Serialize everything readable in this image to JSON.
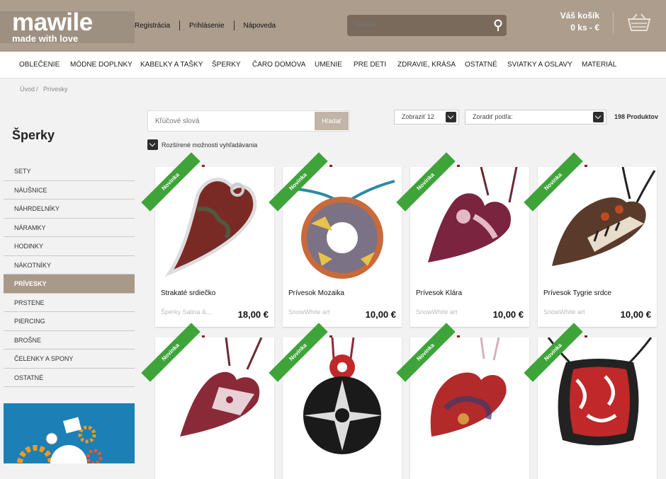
{
  "header": {
    "logo": "mawile",
    "tagline": "made with love",
    "links": [
      "Registrácia",
      "Prihlásenie",
      "Nápoveda"
    ],
    "search_placeholder": "Hľadať",
    "cart_label": "Váš košík",
    "cart_value": "0 ks - €"
  },
  "nav": [
    "OBLEČENIE",
    "MÓDNE DOPLNKY",
    "KABELKY A TAŠKY",
    "ŠPERKY",
    "ČARO DOMOVA",
    "UMENIE",
    "PRE DETI",
    "ZDRAVIE, KRÁSA",
    "OSTATNÉ",
    "SVIATKY A OSLAVY",
    "MATERIÁL"
  ],
  "breadcrumb": [
    "Úvod",
    "Prívesky"
  ],
  "sidebar": {
    "title": "Šperky",
    "items": [
      "SETY",
      "NÁUŠNICE",
      "NÁHRDELNÍKY",
      "NÁRAMKY",
      "HODINKY",
      "NÁKOTNÍKY",
      "PRÍVESKY",
      "PRSTENE",
      "PIERCING",
      "BROŠNE",
      "ČELENKY A SPONY",
      "OSTATNÉ"
    ],
    "active": "PRÍVESKY"
  },
  "filters": {
    "keyword_placeholder": "Kľúčové slová",
    "search_button": "Hľadať",
    "advanced": "Rozšírené možnosti vyhľadávania",
    "show": "Zobraziť 12",
    "sort": "Zoradiť podľa:",
    "count": "198 Produktov"
  },
  "badge": "Novinka",
  "products": [
    {
      "name": "Strakaté srdiečko",
      "seller": "Šperky Salina &...",
      "price": "18,00 €"
    },
    {
      "name": "Prívesok Mozaika",
      "seller": "SnowWhite art",
      "price": "10,00 €"
    },
    {
      "name": "Prívesok Klára",
      "seller": "SnowWhite art",
      "price": "10,00 €"
    },
    {
      "name": "Prívesok Tygrie srdce",
      "seller": "SnowWhite art",
      "price": "10,00 €"
    }
  ],
  "colors": {
    "header": "#ac9d8c",
    "badge": "#3ea43a",
    "active_side": "#a99988"
  }
}
